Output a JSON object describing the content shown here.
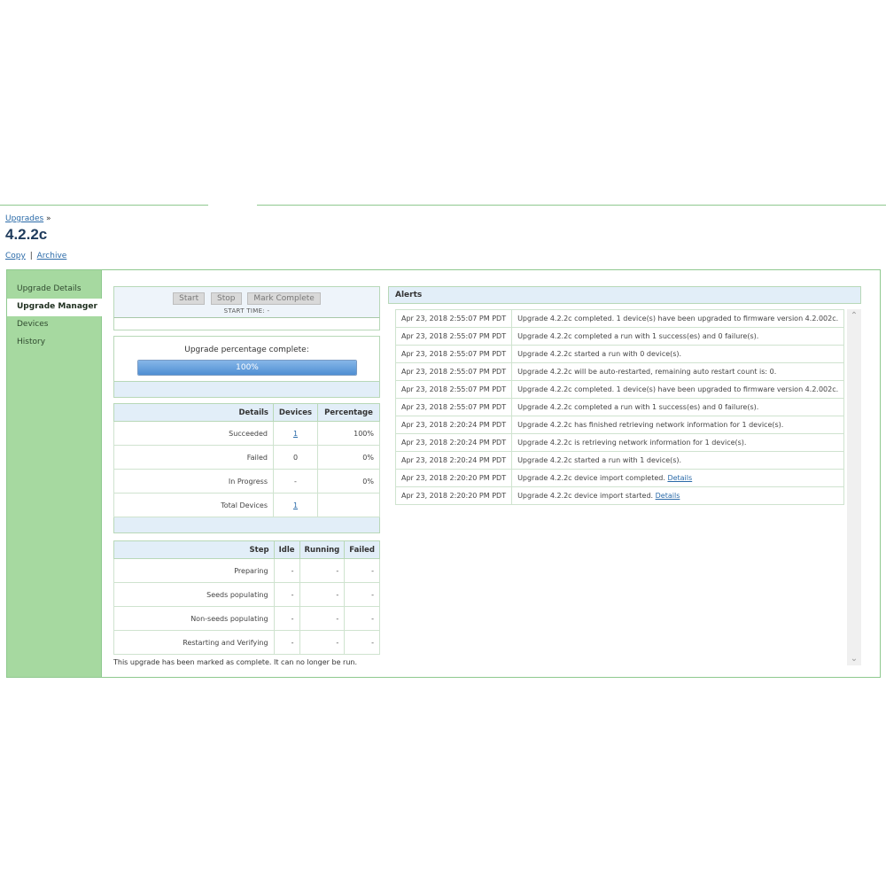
{
  "breadcrumb": {
    "link": "Upgrades",
    "separator": "»"
  },
  "page_title": "4.2.2c",
  "actions": {
    "copy": "Copy",
    "separator": "|",
    "archive": "Archive"
  },
  "sidebar": {
    "items": [
      {
        "label": "Upgrade Details",
        "active": false
      },
      {
        "label": "Upgrade Manager",
        "active": true
      },
      {
        "label": "Devices",
        "active": false
      },
      {
        "label": "History",
        "active": false
      }
    ]
  },
  "controls": {
    "start": "Start",
    "stop": "Stop",
    "mark_complete": "Mark Complete",
    "start_time": "START TIME: -"
  },
  "progress": {
    "label": "Upgrade percentage complete:",
    "value_text": "100%",
    "fraction": 1.0
  },
  "details_table": {
    "headers": [
      "Details",
      "Devices",
      "Percentage"
    ],
    "rows": [
      {
        "label": "Succeeded",
        "devices": "1",
        "devices_link": true,
        "percentage": "100%"
      },
      {
        "label": "Failed",
        "devices": "0",
        "devices_link": false,
        "percentage": "0%"
      },
      {
        "label": "In Progress",
        "devices": "-",
        "devices_link": false,
        "percentage": "0%"
      },
      {
        "label": "Total Devices",
        "devices": "1",
        "devices_link": true,
        "percentage": ""
      }
    ]
  },
  "steps_table": {
    "headers": [
      "Step",
      "Idle",
      "Running",
      "Failed"
    ],
    "rows": [
      {
        "step": "Preparing",
        "idle": "-",
        "running": "-",
        "failed": "-"
      },
      {
        "step": "Seeds populating",
        "idle": "-",
        "running": "-",
        "failed": "-"
      },
      {
        "step": "Non-seeds populating",
        "idle": "-",
        "running": "-",
        "failed": "-"
      },
      {
        "step": "Restarting and Verifying",
        "idle": "-",
        "running": "-",
        "failed": "-"
      }
    ]
  },
  "note": "This upgrade has been marked as complete. It can no longer be run.",
  "alerts": {
    "title": "Alerts",
    "rows": [
      {
        "time": "Apr 23, 2018 2:55:07 PM PDT",
        "message": "Upgrade 4.2.2c completed. 1 device(s) have been upgraded to firmware version 4.2.002c.",
        "link": ""
      },
      {
        "time": "Apr 23, 2018 2:55:07 PM PDT",
        "message": "Upgrade 4.2.2c completed a run with 1 success(es) and 0 failure(s).",
        "link": ""
      },
      {
        "time": "Apr 23, 2018 2:55:07 PM PDT",
        "message": "Upgrade 4.2.2c started a run with 0 device(s).",
        "link": ""
      },
      {
        "time": "Apr 23, 2018 2:55:07 PM PDT",
        "message": "Upgrade 4.2.2c will be auto-restarted, remaining auto restart count is: 0.",
        "link": ""
      },
      {
        "time": "Apr 23, 2018 2:55:07 PM PDT",
        "message": "Upgrade 4.2.2c completed. 1 device(s) have been upgraded to firmware version 4.2.002c.",
        "link": ""
      },
      {
        "time": "Apr 23, 2018 2:55:07 PM PDT",
        "message": "Upgrade 4.2.2c completed a run with 1 success(es) and 0 failure(s).",
        "link": ""
      },
      {
        "time": "Apr 23, 2018 2:20:24 PM PDT",
        "message": "Upgrade 4.2.2c has finished retrieving network information for 1 device(s).",
        "link": ""
      },
      {
        "time": "Apr 23, 2018 2:20:24 PM PDT",
        "message": "Upgrade 4.2.2c is retrieving network information for 1 device(s).",
        "link": ""
      },
      {
        "time": "Apr 23, 2018 2:20:24 PM PDT",
        "message": "Upgrade 4.2.2c started a run with 1 device(s).",
        "link": ""
      },
      {
        "time": "Apr 23, 2018 2:20:20 PM PDT",
        "message": "Upgrade 4.2.2c device import completed. ",
        "link": "Details"
      },
      {
        "time": "Apr 23, 2018 2:20:20 PM PDT",
        "message": "Upgrade 4.2.2c device import started. ",
        "link": "Details"
      }
    ]
  },
  "icons": {
    "scroll_up": "chevron-up-icon",
    "scroll_down": "chevron-down-icon"
  },
  "colors": {
    "sidebar": "#a6d9a0",
    "border": "#8fc98f",
    "header_bg": "#e2eef8",
    "link": "#2a6aa8",
    "progress": "#4f8fd3"
  }
}
